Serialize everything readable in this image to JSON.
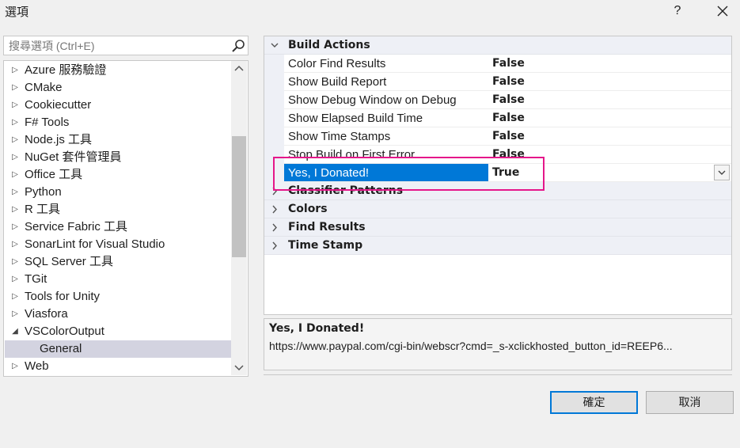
{
  "window": {
    "title": "選項",
    "help_label": "?"
  },
  "search": {
    "placeholder": "搜尋選項 (Ctrl+E)"
  },
  "tree": {
    "items": [
      {
        "label": "Azure 服務驗證",
        "expanded": false
      },
      {
        "label": "CMake",
        "expanded": false
      },
      {
        "label": "Cookiecutter",
        "expanded": false
      },
      {
        "label": "F# Tools",
        "expanded": false
      },
      {
        "label": "Node.js 工具",
        "expanded": false
      },
      {
        "label": "NuGet 套件管理員",
        "expanded": false
      },
      {
        "label": "Office 工具",
        "expanded": false
      },
      {
        "label": "Python",
        "expanded": false
      },
      {
        "label": "R 工具",
        "expanded": false
      },
      {
        "label": "Service Fabric 工具",
        "expanded": false
      },
      {
        "label": "SonarLint for Visual Studio",
        "expanded": false
      },
      {
        "label": "SQL Server 工具",
        "expanded": false
      },
      {
        "label": "TGit",
        "expanded": false
      },
      {
        "label": "Tools for Unity",
        "expanded": false
      },
      {
        "label": "Viasfora",
        "expanded": false
      },
      {
        "label": "VSColorOutput",
        "expanded": true
      },
      {
        "label": "General",
        "child": true,
        "selected": true
      },
      {
        "label": "Web",
        "expanded": false
      }
    ],
    "collapsed_glyph": "▷",
    "expanded_glyph": "◢"
  },
  "property_grid": {
    "rows": [
      {
        "kind": "category",
        "label": "Build Actions",
        "expanded": true
      },
      {
        "kind": "property",
        "name": "Color Find Results",
        "value": "False"
      },
      {
        "kind": "property",
        "name": "Show Build Report",
        "value": "False"
      },
      {
        "kind": "property",
        "name": "Show Debug Window on Debug",
        "value": "False"
      },
      {
        "kind": "property",
        "name": "Show Elapsed Build Time",
        "value": "False"
      },
      {
        "kind": "property",
        "name": "Show Time Stamps",
        "value": "False"
      },
      {
        "kind": "property",
        "name": "Stop Build on First Error",
        "value": "False"
      },
      {
        "kind": "property",
        "name": "Yes, I Donated!",
        "value": "True",
        "selected": true
      },
      {
        "kind": "category",
        "label": "Classifier Patterns",
        "expanded": false
      },
      {
        "kind": "category",
        "label": "Colors",
        "expanded": false
      },
      {
        "kind": "category",
        "label": "Find Results",
        "expanded": false
      },
      {
        "kind": "category",
        "label": "Time Stamp",
        "expanded": false
      }
    ]
  },
  "description": {
    "title": "Yes, I Donated!",
    "text": "https://www.paypal.com/cgi-bin/webscr?cmd=_s-xclickhosted_button_id=REEP6..."
  },
  "buttons": {
    "ok_label": "確定",
    "cancel_label": "取消"
  },
  "colors": {
    "selection": "#0078d7",
    "highlight_annotation": "#e5178a",
    "tree_selected": "#d3d3e0"
  }
}
